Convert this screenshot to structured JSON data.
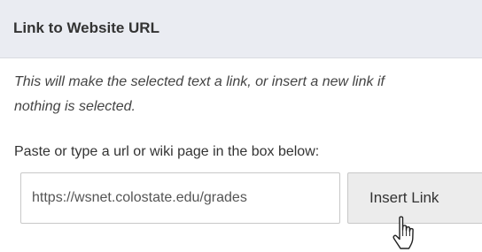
{
  "dialog": {
    "title": "Link to Website URL",
    "description_line1": "This will make the selected text a link, or insert a new link if",
    "description_line2": "nothing is selected.",
    "instruction": "Paste or type a url or wiki page in the box below:",
    "url_input_value": "https://wsnet.colostate.edu/grades",
    "insert_button_label": "Insert Link"
  },
  "cursor": {
    "icon": "hand-pointer-icon"
  },
  "colors": {
    "header_background": "#eaecf2",
    "button_background": "#ececec",
    "border": "#c8c8c8"
  }
}
